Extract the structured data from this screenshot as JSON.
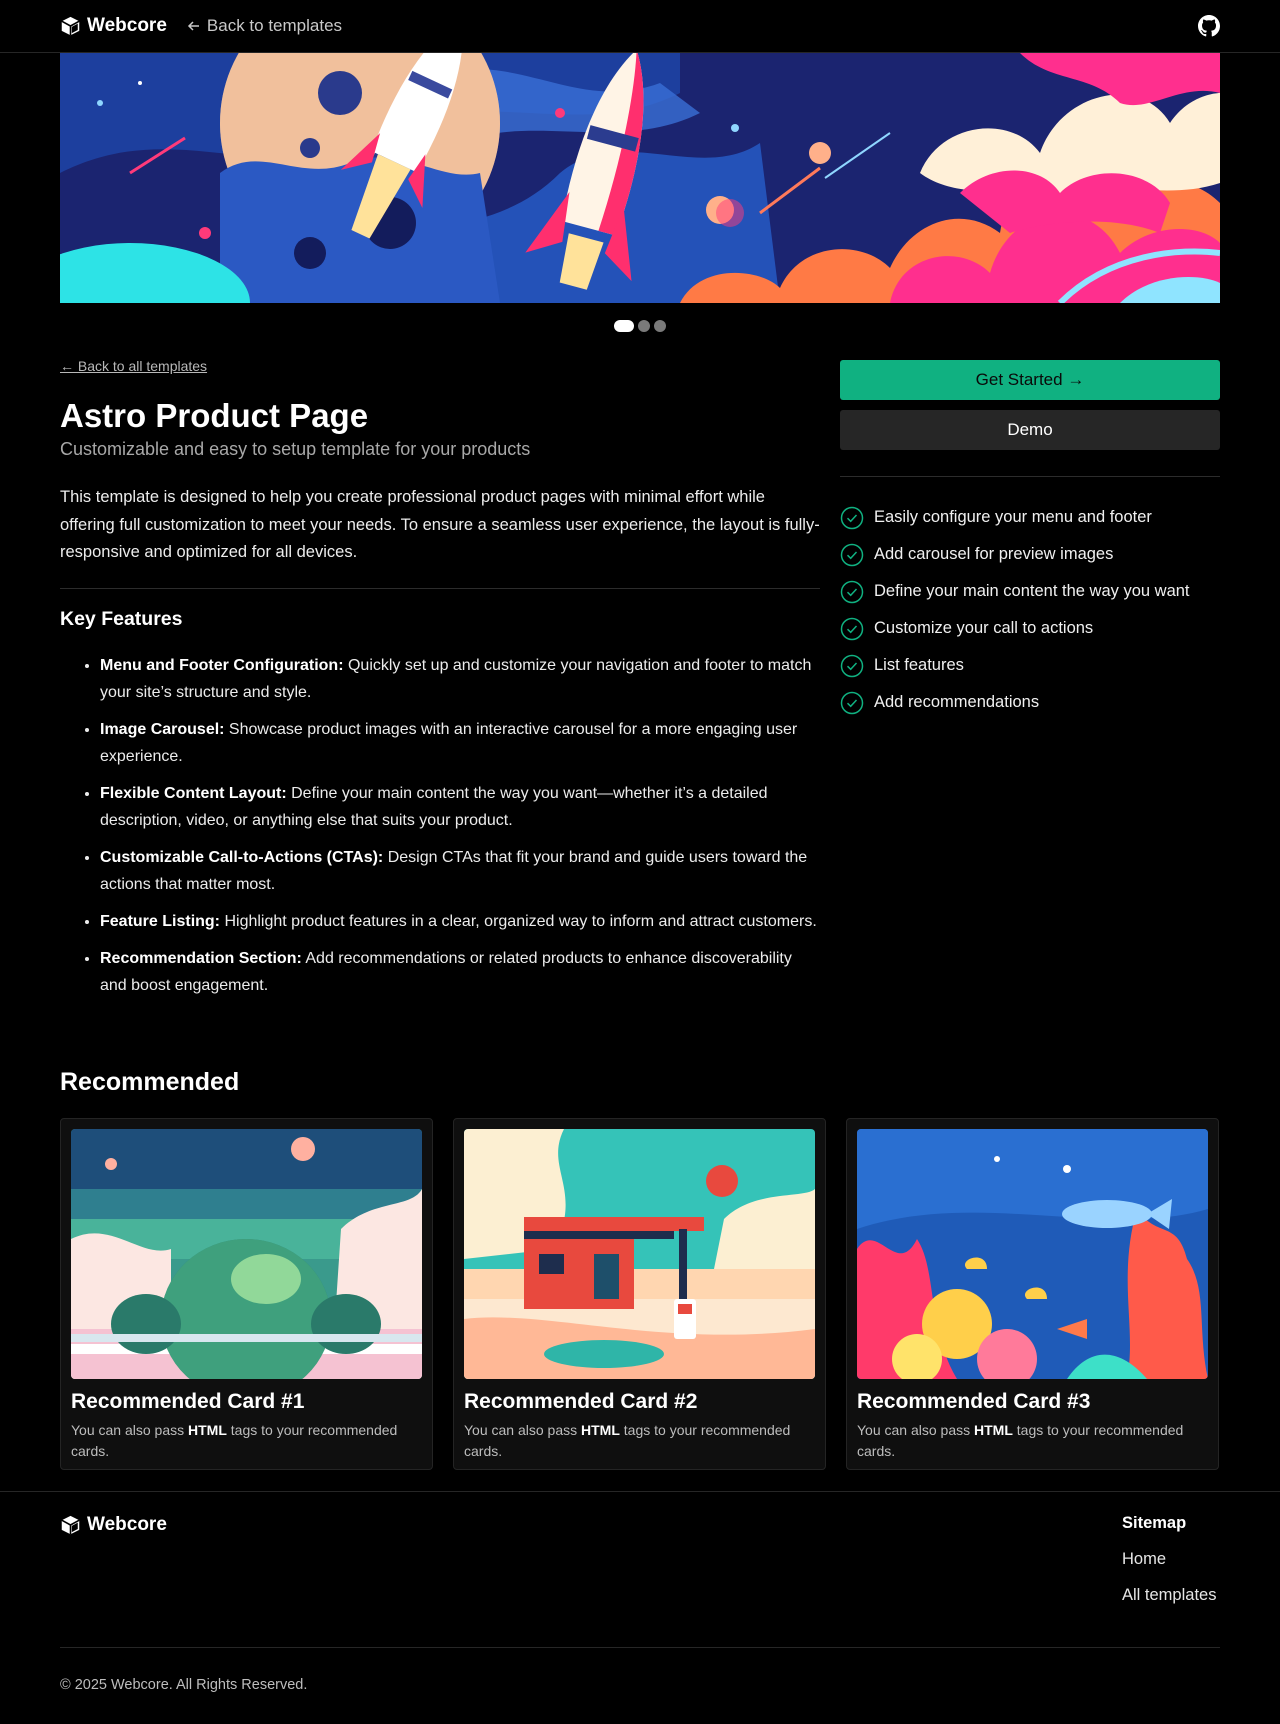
{
  "header": {
    "brand": "Webcore",
    "back_link": "Back to templates"
  },
  "carousel": {
    "slides": 3,
    "active_index": 0
  },
  "main": {
    "back_all": "← Back to all templates",
    "title": "Astro Product Page",
    "subtitle": "Customizable and easy to setup template for your products",
    "description": "This template is designed to help you create professional product pages with minimal effort while offering full customization to meet your needs. To ensure a seamless user experience, the layout is fully-responsive and optimized for all devices.",
    "key_features_title": "Key Features",
    "features": [
      {
        "label": "Menu and Footer Configuration:",
        "text": " Quickly set up and customize your navigation and footer to match your site’s structure and style."
      },
      {
        "label": "Image Carousel:",
        "text": " Showcase product images with an interactive carousel for a more engaging user experience."
      },
      {
        "label": "Flexible Content Layout:",
        "text": " Define your main content the way you want—whether it’s a detailed description, video, or anything else that suits your product."
      },
      {
        "label": "Customizable Call-to-Actions (CTAs):",
        "text": " Design CTAs that fit your brand and guide users toward the actions that matter most."
      },
      {
        "label": "Feature Listing:",
        "text": " Highlight product features in a clear, organized way to inform and attract customers."
      },
      {
        "label": "Recommendation Section:",
        "text": " Add recommendations or related products to enhance discoverability and boost engagement."
      }
    ]
  },
  "sidebar": {
    "primary_button": "Get Started →",
    "secondary_button": "Demo",
    "checks": [
      "Easily configure your menu and footer",
      "Add carousel for preview images",
      "Define your main content the way you want",
      "Customize your call to actions",
      "List features",
      "Add recommendations"
    ]
  },
  "recommended": {
    "title": "Recommended",
    "cards": [
      {
        "title": "Recommended Card #1",
        "text_before": "You can also pass ",
        "bold": "HTML",
        "text_after": " tags to your recommended cards."
      },
      {
        "title": "Recommended Card #2",
        "text_before": "You can also pass ",
        "bold": "HTML",
        "text_after": " tags to your recommended cards."
      },
      {
        "title": "Recommended Card #3",
        "text_before": "You can also pass ",
        "bold": "HTML",
        "text_after": " tags to your recommended cards."
      }
    ]
  },
  "footer": {
    "brand": "Webcore",
    "sitemap_title": "Sitemap",
    "links": [
      "Home",
      "All templates"
    ],
    "copyright": "© 2025 Webcore. All Rights Reserved."
  },
  "colors": {
    "accent": "#10b181",
    "background": "#000000"
  },
  "icons": [
    "cube-logo-icon",
    "arrow-left-icon",
    "github-icon",
    "check-circle-icon"
  ]
}
